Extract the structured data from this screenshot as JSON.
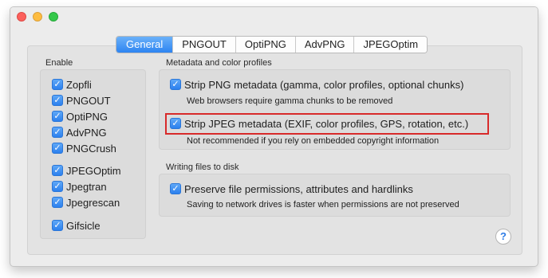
{
  "tabs": [
    "General",
    "PNGOUT",
    "OptiPNG",
    "AdvPNG",
    "JPEGOptim"
  ],
  "enable": {
    "heading": "Enable",
    "items": [
      "Zopfli",
      "PNGOUT",
      "OptiPNG",
      "AdvPNG",
      "PNGCrush",
      "JPEGOptim",
      "Jpegtran",
      "Jpegrescan",
      "Gifsicle"
    ],
    "checked": true
  },
  "metadata": {
    "heading": "Metadata and color profiles",
    "strip_png": {
      "label": "Strip PNG metadata (gamma, color profiles, optional chunks)",
      "note": "Web browsers require gamma chunks to be removed",
      "checked": true
    },
    "strip_jpeg": {
      "label": "Strip JPEG metadata (EXIF, color profiles, GPS, rotation, etc.)",
      "note": "Not recommended if you rely on embedded copyright information",
      "checked": true
    }
  },
  "writing": {
    "heading": "Writing files to disk",
    "preserve": {
      "label": "Preserve file permissions, attributes and hardlinks",
      "note": "Saving to network drives is faster when permissions are not preserved",
      "checked": true
    }
  },
  "help": {
    "glyph": "?"
  },
  "checkmark": "✓",
  "colors": {
    "accent": "#2d84f1",
    "highlight": "#d82a2a"
  }
}
